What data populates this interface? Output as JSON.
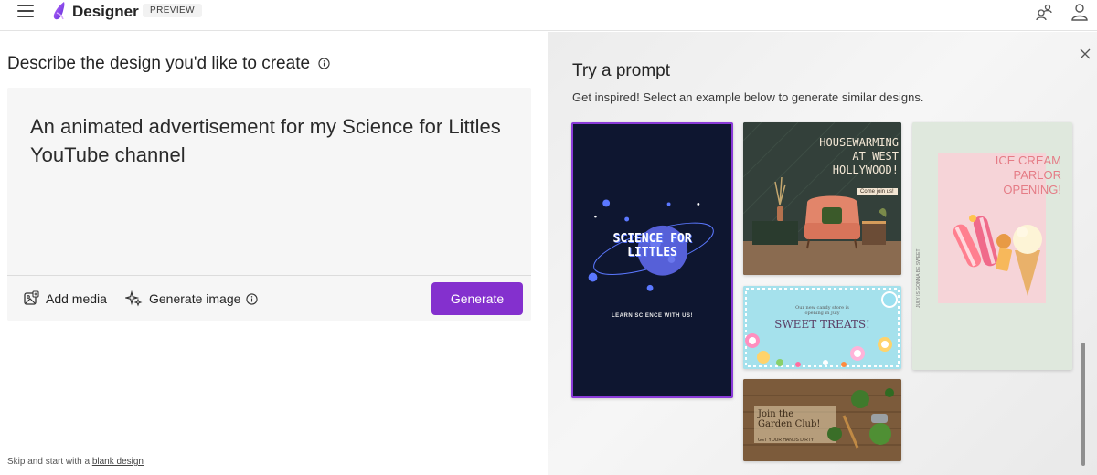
{
  "header": {
    "brand": "Designer",
    "badge": "PREVIEW"
  },
  "left": {
    "heading": "Describe the design you'd like to create",
    "prompt_text": "An animated advertisement for my Science for Littles YouTube channel",
    "add_media_label": "Add media",
    "generate_image_label": "Generate image",
    "generate_button_label": "Generate",
    "skip_prefix": "Skip and start with a",
    "skip_link": "blank design"
  },
  "right": {
    "heading": "Try a prompt",
    "subheading": "Get inspired! Select an example below to generate similar designs.",
    "cards": {
      "science": {
        "title_line1": "SCIENCE FOR",
        "title_line2": "LITTLES",
        "tagline": "LEARN SCIENCE WITH US!"
      },
      "housewarming": {
        "line1": "HOUSEWARMING",
        "line2": "AT WEST",
        "line3": "HOLLYWOOD!",
        "tag": "Come join us!"
      },
      "ice_cream": {
        "line1": "ICE CREAM",
        "line2": "PARLOR",
        "line3": "OPENING!",
        "side_text": "JULY IS GONNA BE SWEET!"
      },
      "candy": {
        "small_line1": "Our new candy store is",
        "small_line2": "opening in July",
        "title": "SWEET TREATS!"
      },
      "garden": {
        "line1": "Join the",
        "line2": "Garden Club!",
        "tag": "GET YOUR HANDS DIRTY"
      }
    }
  },
  "colors": {
    "accent": "#8430ce",
    "science_bg": "#0e1630",
    "selected_border": "#8a3bd8"
  },
  "icons": [
    "hamburger-icon",
    "designer-logo-icon",
    "share-people-icon",
    "account-icon",
    "info-icon",
    "add-media-icon",
    "sparkle-icon",
    "close-icon"
  ]
}
